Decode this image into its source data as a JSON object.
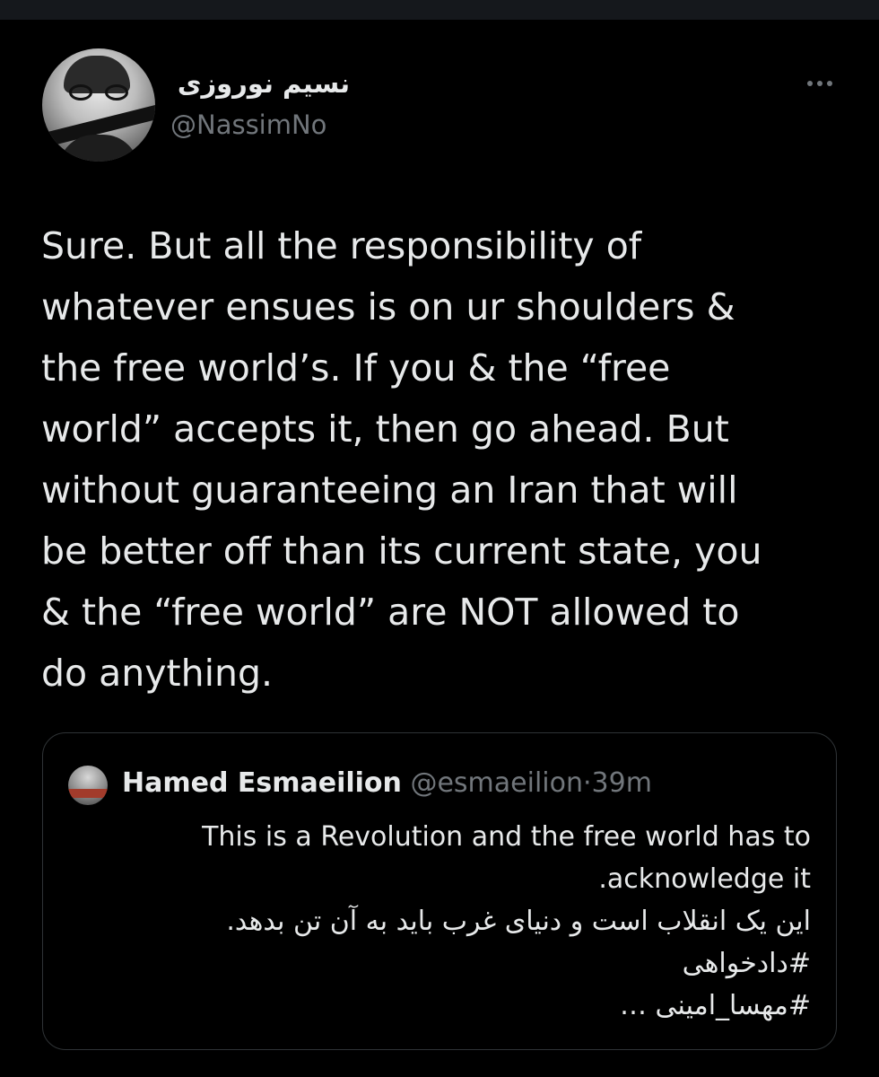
{
  "author": {
    "display_name": "نسیم نوروزی",
    "handle": "@NassimNo"
  },
  "tweet": {
    "text": "Sure. But all the responsibility of\nwhatever ensues is on ur shoulders &\nthe free world’s. If you & the “free\nworld” accepts it, then go ahead. But\nwithout guaranteeing an Iran that will\nbe better off than its current state, you\n& the “free world” are NOT allowed to\ndo anything."
  },
  "quoted": {
    "name": "Hamed Esmaeilion",
    "handle": "@esmaeilion",
    "separator": "·",
    "time": "39m",
    "lines": [
      "This is a Revolution and the free world has to",
      ".acknowledge it",
      "این یک انقلاب است و دنیای غرب باید به آن تن بدهد.",
      "#دادخواهی",
      "#مهسا_امینی …"
    ]
  },
  "icons": {
    "more": "more-horizontal-icon"
  },
  "colors": {
    "background": "#000000",
    "text_primary": "#e7e9ea",
    "text_secondary": "#71767b",
    "border": "#2f3336"
  }
}
